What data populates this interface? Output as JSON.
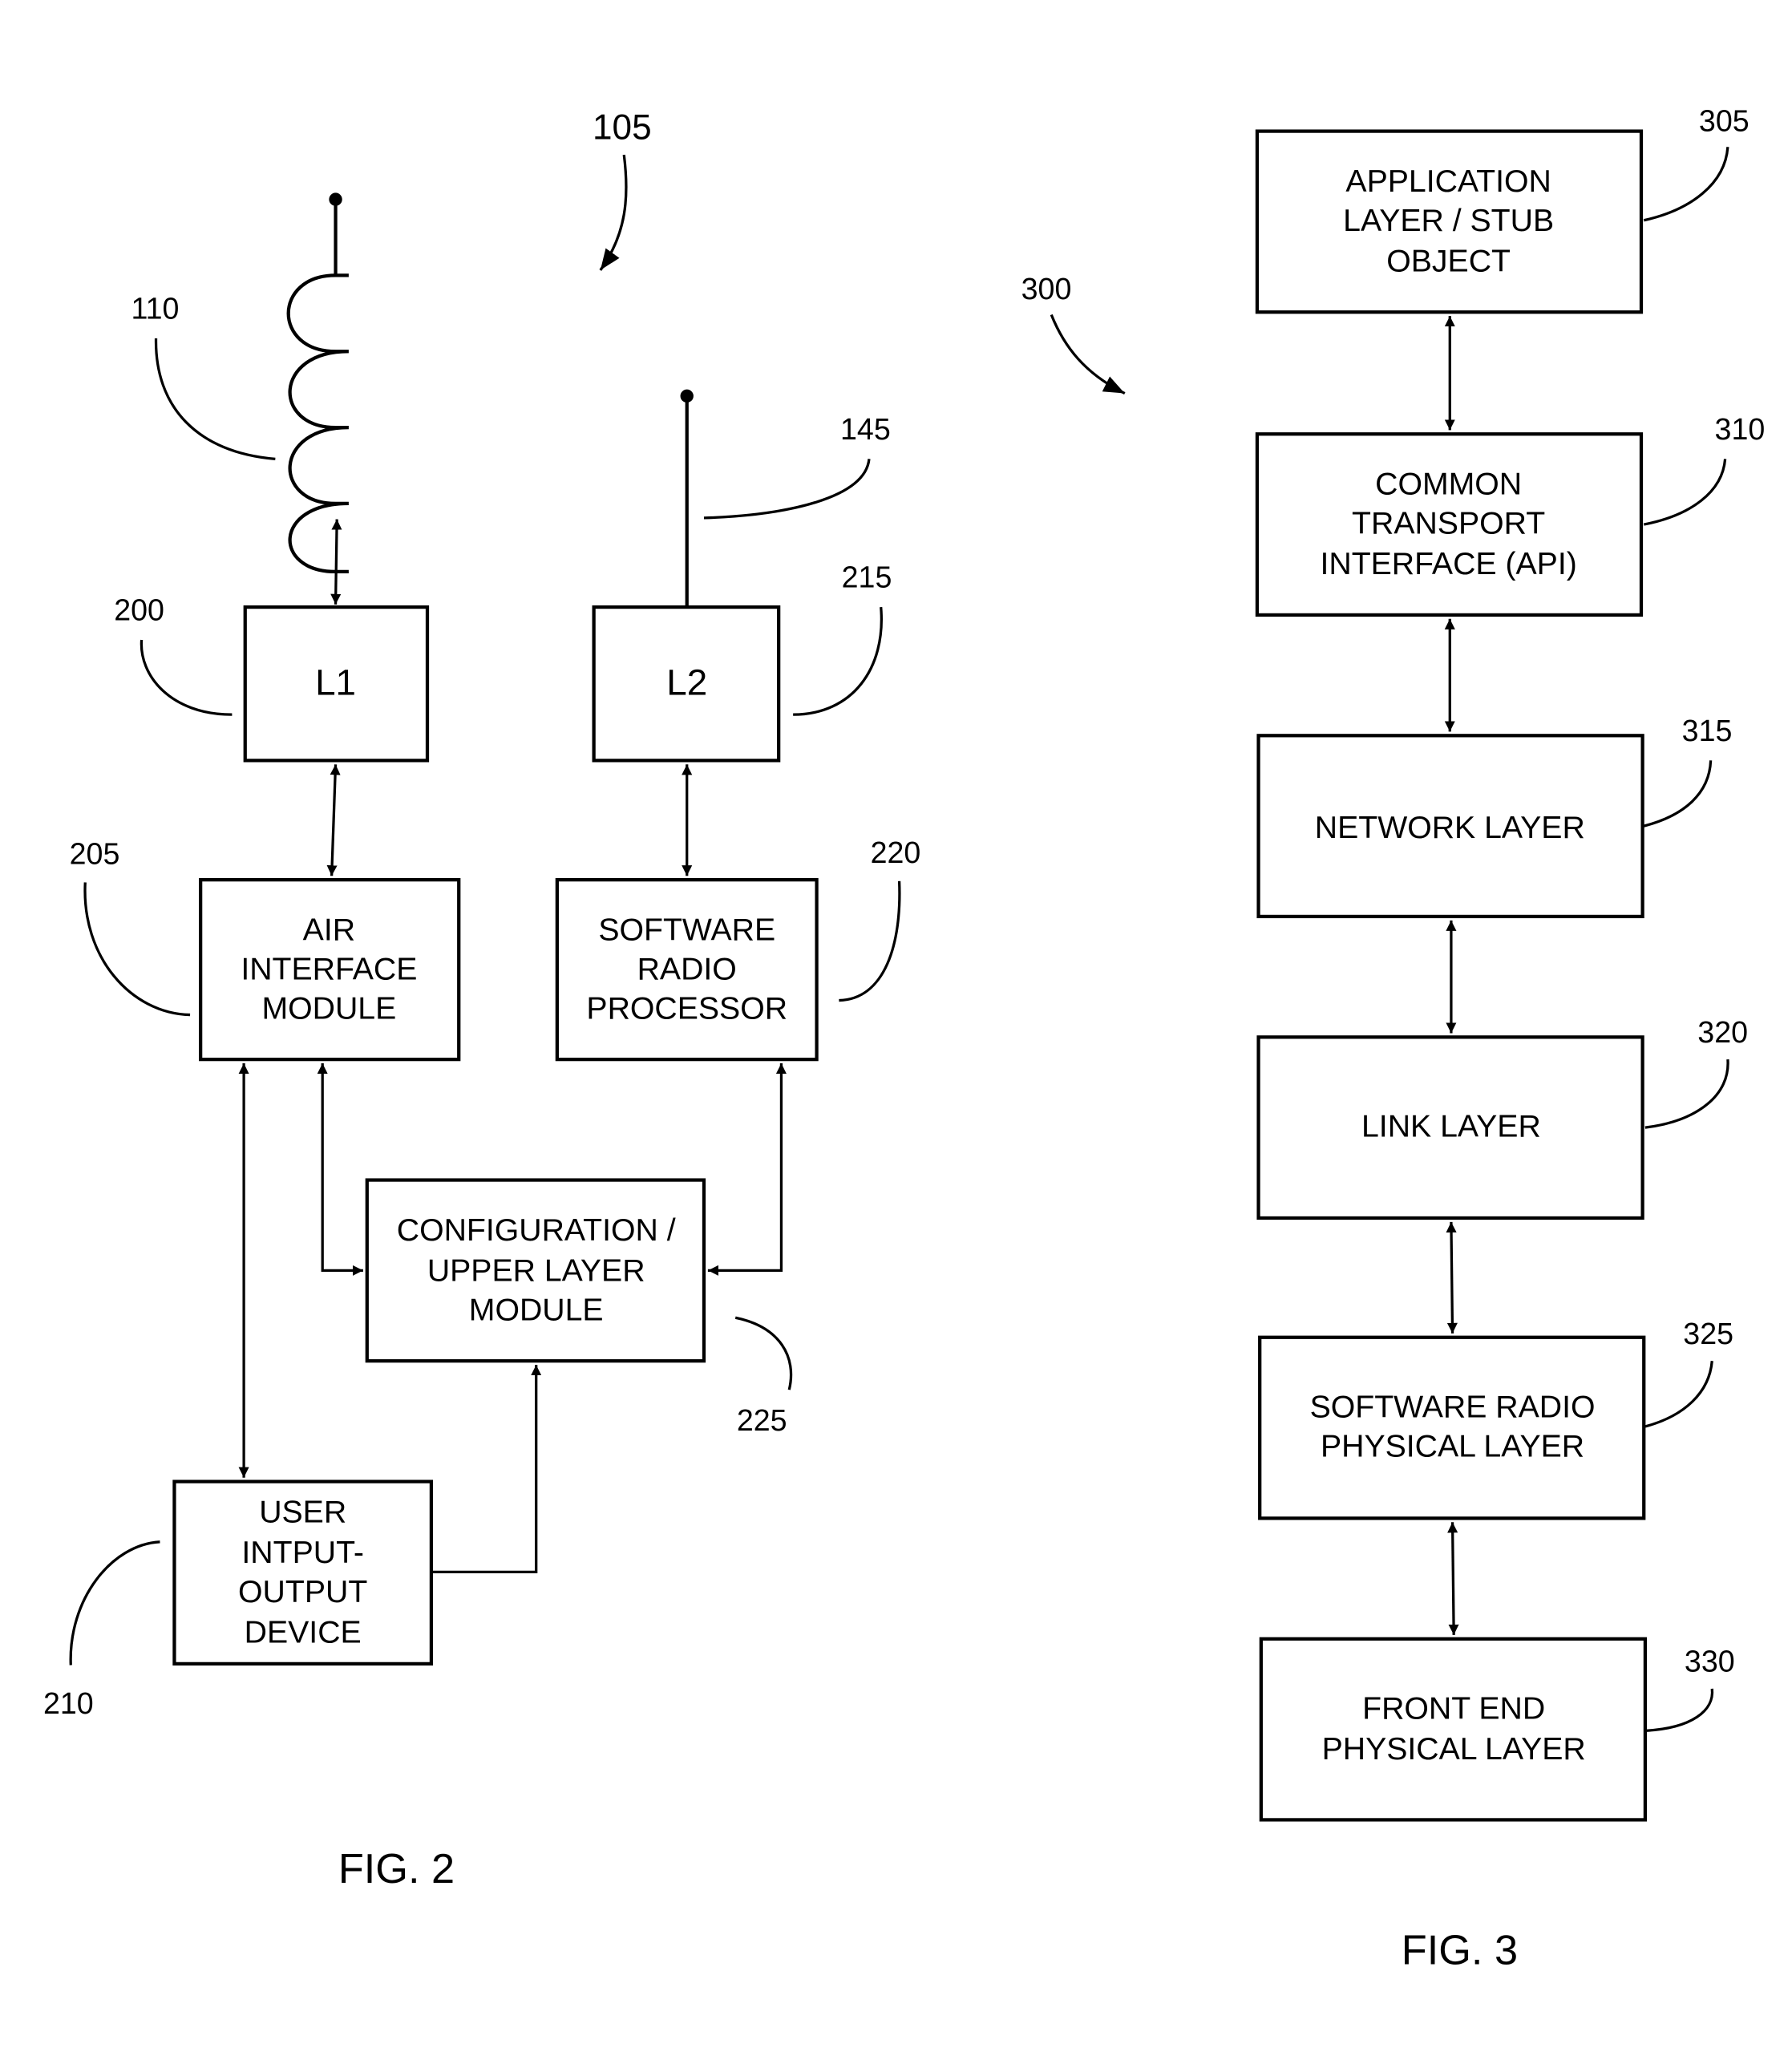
{
  "fig2": {
    "caption": "FIG. 2",
    "ref_system": "105",
    "ref_coil_antenna": "110",
    "ref_whip_antenna": "145",
    "blocks": {
      "l1": {
        "ref": "200",
        "lines": [
          "L1"
        ]
      },
      "l2": {
        "ref": "215",
        "lines": [
          "L2"
        ]
      },
      "air_interface": {
        "ref": "205",
        "lines": [
          "AIR",
          "INTERFACE",
          "MODULE"
        ]
      },
      "software_radio_processor": {
        "ref": "220",
        "lines": [
          "SOFTWARE",
          "RADIO",
          "PROCESSOR"
        ]
      },
      "configuration": {
        "ref": "225",
        "lines": [
          "CONFIGURATION /",
          "UPPER LAYER",
          "MODULE"
        ]
      },
      "user_io": {
        "ref": "210",
        "lines": [
          "USER",
          "INTPUT-",
          "OUTPUT",
          "DEVICE"
        ]
      }
    }
  },
  "fig3": {
    "caption": "FIG. 3",
    "ref_stack": "300",
    "layers": [
      {
        "ref": "305",
        "lines": [
          "APPLICATION",
          "LAYER / STUB",
          "OBJECT"
        ]
      },
      {
        "ref": "310",
        "lines": [
          "COMMON",
          "TRANSPORT",
          "INTERFACE (API)"
        ]
      },
      {
        "ref": "315",
        "lines": [
          "NETWORK LAYER"
        ]
      },
      {
        "ref": "320",
        "lines": [
          "LINK LAYER"
        ]
      },
      {
        "ref": "325",
        "lines": [
          "SOFTWARE RADIO",
          "PHYSICAL LAYER"
        ]
      },
      {
        "ref": "330",
        "lines": [
          "FRONT END",
          "PHYSICAL LAYER"
        ]
      }
    ]
  }
}
